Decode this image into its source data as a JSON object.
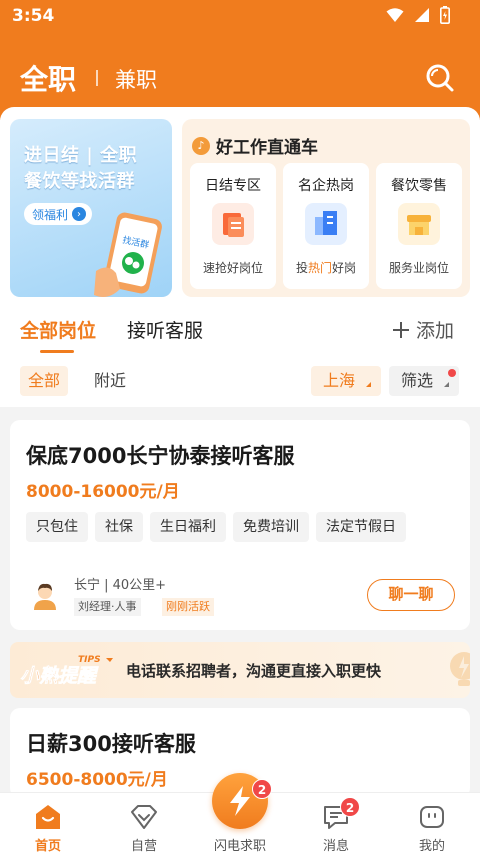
{
  "status_bar": {
    "time": "3:54"
  },
  "top_nav": {
    "tab_full": "全职",
    "tab_part": "兼职"
  },
  "banner": {
    "line1": "进日结 | 全职",
    "line2": "餐饮等找活群",
    "tag": "领福利",
    "phone_label": "找活群"
  },
  "direct": {
    "title": "好工作直通车",
    "cards": [
      {
        "title": "日结专区",
        "sub": "速抢好岗位"
      },
      {
        "title": "名企热岗",
        "sub_pre": "投",
        "sub_hot": "热门",
        "sub_post": "好岗"
      },
      {
        "title": "餐饮零售",
        "sub": "服务业岗位"
      }
    ]
  },
  "tabs": {
    "all": "全部岗位",
    "cs": "接听客服",
    "add": "添加"
  },
  "chips": {
    "all": "全部",
    "near": "附近",
    "city": "上海",
    "filter": "筛选"
  },
  "jobs": [
    {
      "title": "保底7000长宁协泰接听客服",
      "salary": "8000-16000元/月",
      "tags": [
        "只包住",
        "社保",
        "生日福利",
        "免费培训",
        "法定节假日"
      ],
      "location": "长宁 | 40公里+",
      "recruiter": "刘经理·人事",
      "active": "刚刚活跃",
      "chat": "聊一聊"
    },
    {
      "title": "日薪300接听客服",
      "salary": "6500-8000元/月"
    }
  ],
  "tips": {
    "label_en": "TIPS",
    "label": "小熟提醒",
    "text": "电话联系招聘者，沟通更直接入职更快"
  },
  "bottom_nav": {
    "home": "首页",
    "self": "自营",
    "flash": "闪电求职",
    "flash_badge": "2",
    "msg": "消息",
    "msg_badge": "2",
    "mine": "我的"
  },
  "colors": {
    "brand": "#f07c1e",
    "badge": "#f04848"
  }
}
